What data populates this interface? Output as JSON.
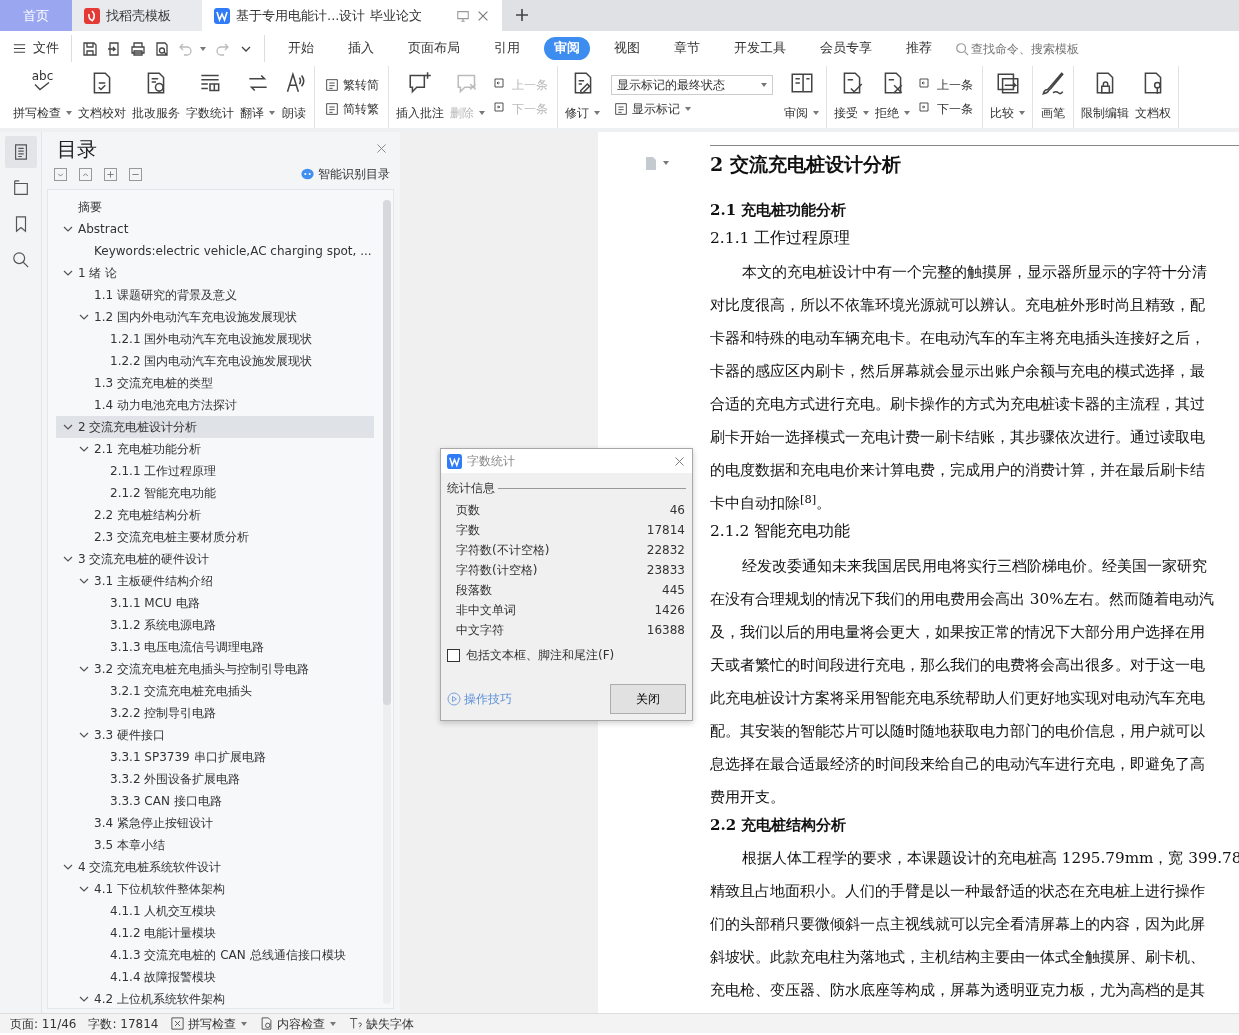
{
  "browser_tabs": [
    {
      "kind": "home",
      "label": "首页",
      "selected": false
    },
    {
      "kind": "template",
      "label": "找稻壳模板",
      "selected": false
    },
    {
      "kind": "document",
      "label": "基于专用电能计...设计 毕业论文",
      "selected": true
    }
  ],
  "menu": {
    "file": "文件",
    "quick_access": [
      {
        "kind": "save",
        "disabled": false
      },
      {
        "kind": "export",
        "disabled": false
      },
      {
        "kind": "print",
        "disabled": false
      },
      {
        "kind": "preview",
        "disabled": false
      },
      {
        "kind": "undo",
        "disabled": true
      },
      {
        "kind": "redo",
        "disabled": true
      },
      {
        "kind": "more",
        "disabled": false
      }
    ],
    "tabs": [
      {
        "label": "开始",
        "selected": false
      },
      {
        "label": "插入",
        "selected": false
      },
      {
        "label": "页面布局",
        "selected": false
      },
      {
        "label": "引用",
        "selected": false
      },
      {
        "label": "审阅",
        "selected": true
      },
      {
        "label": "视图",
        "selected": false
      },
      {
        "label": "章节",
        "selected": false
      },
      {
        "label": "开发工具",
        "selected": false
      },
      {
        "label": "会员专享",
        "selected": false
      },
      {
        "label": "推荐",
        "selected": false
      }
    ],
    "search": {
      "placeholder": "查找命令、搜索模板"
    }
  },
  "ribbon_groups": [
    {
      "items": [
        {
          "kind": "big",
          "glyph": "abc",
          "label": "拼写检查",
          "dropdown": true,
          "disabled": false
        },
        {
          "kind": "big",
          "label": "文档校对",
          "dropdown": false,
          "disabled": false
        },
        {
          "kind": "big",
          "label": "批改服务",
          "dropdown": false,
          "disabled": false
        },
        {
          "kind": "big",
          "label": "字数统计",
          "dropdown": false,
          "disabled": false
        },
        {
          "kind": "big",
          "label": "翻译",
          "dropdown": true,
          "disabled": false
        },
        {
          "kind": "big",
          "label": "朗读",
          "dropdown": false,
          "disabled": false
        }
      ]
    },
    {
      "items": [
        {
          "kind": "pair",
          "items": [
            {
              "label": "繁转简",
              "disabled": false
            },
            {
              "label": "简转繁",
              "disabled": false
            }
          ]
        }
      ]
    },
    {
      "items": [
        {
          "kind": "big",
          "label": "插入批注",
          "dropdown": false,
          "disabled": false
        },
        {
          "kind": "big",
          "label": "删除",
          "dropdown": true,
          "disabled": true
        },
        {
          "kind": "pair",
          "items": [
            {
              "label": "上一条",
              "disabled": true
            },
            {
              "label": "下一条",
              "disabled": true
            }
          ]
        }
      ]
    },
    {
      "items": [
        {
          "kind": "big",
          "label": "修订",
          "dropdown": true,
          "disabled": false
        },
        {
          "kind": "select",
          "value": "显示标记的最终状态",
          "below": {
            "label": "显示标记",
            "dropdown": true
          }
        },
        {
          "kind": "big",
          "label": "审阅",
          "dropdown": true,
          "disabled": false
        }
      ]
    },
    {
      "items": [
        {
          "kind": "big",
          "label": "接受",
          "dropdown": true,
          "disabled": false
        },
        {
          "kind": "big",
          "label": "拒绝",
          "dropdown": true,
          "disabled": false
        },
        {
          "kind": "pair",
          "items": [
            {
              "label": "上一条",
              "disabled": false
            },
            {
              "label": "下一条",
              "disabled": false
            }
          ]
        }
      ]
    },
    {
      "items": [
        {
          "kind": "big",
          "label": "比较",
          "dropdown": true,
          "disabled": false
        }
      ]
    },
    {
      "items": [
        {
          "kind": "big",
          "label": "画笔",
          "dropdown": false,
          "disabled": false
        }
      ]
    },
    {
      "items": [
        {
          "kind": "big",
          "label": "限制编辑",
          "dropdown": false,
          "disabled": false
        },
        {
          "kind": "big",
          "label": "文档权",
          "dropdown": false,
          "disabled": false
        }
      ]
    }
  ],
  "side_rail": [
    {
      "kind": "outline",
      "selected": true
    },
    {
      "kind": "pages",
      "selected": false
    },
    {
      "kind": "bookmark",
      "selected": false
    },
    {
      "kind": "search",
      "selected": false
    }
  ],
  "nav_pane": {
    "title": "目录",
    "tools": [
      {
        "kind": "expand"
      },
      {
        "kind": "collapse"
      },
      {
        "kind": "plus"
      },
      {
        "kind": "minus"
      }
    ],
    "smart_button": "智能识别目录",
    "tree": [
      {
        "label": "摘要",
        "selected": false
      },
      {
        "label": "Abstract",
        "expanded": true,
        "selected": false,
        "children": [
          {
            "label": "Keywords:electric vehicle,AC charging spot, ...",
            "selected": false
          }
        ]
      },
      {
        "label": "1  绪  论",
        "expanded": true,
        "selected": false,
        "children": [
          {
            "label": "1.1  课题研究的背景及意义",
            "selected": false
          },
          {
            "label": "1.2  国内外电动汽车充电设施发展现状",
            "expanded": true,
            "selected": false,
            "children": [
              {
                "label": "1.2.1  国外电动汽车充电设施发展现状",
                "selected": false
              },
              {
                "label": "1.2.2  国内电动汽车充电设施发展现状",
                "selected": false
              }
            ]
          },
          {
            "label": "1.3  交流充电桩的类型",
            "selected": false
          },
          {
            "label": "1.4  动力电池充电方法探讨",
            "selected": false
          }
        ]
      },
      {
        "label": "2  交流充电桩设计分析",
        "expanded": true,
        "selected": true,
        "children": [
          {
            "label": "2.1 充电桩功能分析",
            "expanded": true,
            "selected": false,
            "children": [
              {
                "label": "2.1.1  工作过程原理",
                "selected": false
              },
              {
                "label": "2.1.2  智能充电功能",
                "selected": false
              }
            ]
          },
          {
            "label": "2.2  充电桩结构分析",
            "selected": false
          },
          {
            "label": "2.3  交流充电桩主要材质分析",
            "selected": false
          }
        ]
      },
      {
        "label": "3  交流充电桩的硬件设计",
        "expanded": true,
        "selected": false,
        "children": [
          {
            "label": "3.1  主板硬件结构介绍",
            "expanded": true,
            "selected": false,
            "children": [
              {
                "label": "3.1.1 MCU 电路",
                "selected": false
              },
              {
                "label": "3.1.2  系统电源电路",
                "selected": false
              },
              {
                "label": "3.1.3 电压电流信号调理电路",
                "selected": false
              }
            ]
          },
          {
            "label": "3.2  交流充电桩充电插头与控制引导电路",
            "expanded": true,
            "selected": false,
            "children": [
              {
                "label": "3.2.1  交流充电桩充电插头",
                "selected": false
              },
              {
                "label": "3.2.2  控制导引电路",
                "selected": false
              }
            ]
          },
          {
            "label": "3.3  硬件接口",
            "expanded": true,
            "selected": false,
            "children": [
              {
                "label": "3.3.1 SP3739 串口扩展电路",
                "selected": false
              },
              {
                "label": "3.3.2  外围设备扩展电路",
                "selected": false
              },
              {
                "label": "3.3.3 CAN  接口电路",
                "selected": false
              }
            ]
          },
          {
            "label": "3.4  紧急停止按钮设计",
            "selected": false
          },
          {
            "label": "3.5  本章小结",
            "selected": false
          }
        ]
      },
      {
        "label": "4  交流充电桩系统软件设计",
        "expanded": true,
        "selected": false,
        "children": [
          {
            "label": "4.1 下位机软件整体架构",
            "expanded": true,
            "selected": false,
            "children": [
              {
                "label": "4.1.1  人机交互模块",
                "selected": false
              },
              {
                "label": "4.1.2  电能计量模块",
                "selected": false
              },
              {
                "label": "4.1.3 交流充电桩的 CAN 总线通信接口模块",
                "selected": false
              },
              {
                "label": "4.1.4 故障报警模块",
                "selected": false
              }
            ]
          },
          {
            "label": "4.2 上位机系统软件架构",
            "expanded": true,
            "selected": false
          }
        ]
      }
    ]
  },
  "document": [
    {
      "kind": "h1",
      "text": "2  交流充电桩设计分析"
    },
    {
      "kind": "h2",
      "text": "2.1 充电桩功能分析"
    },
    {
      "kind": "h3",
      "text": "2.1.1  工作过程原理"
    },
    {
      "kind": "para",
      "lines": [
        "本文的充电桩设计中有一个完整的触摸屏，显示器所显示的字符十分清",
        "对比度很高，所以不依靠环境光源就可以辨认。充电桩外形时尚且精致，配",
        "卡器和特殊的电动车辆充电卡。在电动汽车的车主将充电插头连接好之后，",
        "卡器的感应区内刷卡，然后屏幕就会显示出账户余额与充电的模式选择，最",
        "合适的充电方式进行充电。刷卡操作的方式为充电桩读卡器的主流程，其过",
        "刷卡开始一选择模式一充电计费一刷卡结账，其步骤依次进行。通过读取电",
        "的电度数据和充电电价来计算电费，完成用户的消费计算，并在最后刷卡结",
        "卡中自动扣除$^{[8]}$。"
      ]
    },
    {
      "kind": "h3",
      "text": "2.1.2  智能充电功能"
    },
    {
      "kind": "para",
      "lines": [
        "经发改委通知未来我国居民用电将实行三档阶梯电价。经美国一家研究",
        "在没有合理规划的情况下我们的用电费用会高出 30%左右。然而随着电动汽",
        "及，我们以后的用电量将会更大，如果按正常的情况下大部分用户选择在用",
        "天或者繁忙的时间段进行充电，那么我们的电费将会高出很多。对于这一电",
        "此充电桩设计方案将采用智能充电系统帮助人们更好地实现对电动汽车充电",
        "配。其安装的智能芯片可以随时随地获取电力部门的电价信息，用户就可以",
        "息选择在最合适最经济的时间段来给自己的电动汽车进行充电，即避免了高",
        "费用开支。"
      ]
    },
    {
      "kind": "h2",
      "text": "2.2  充电桩结构分析"
    },
    {
      "kind": "para",
      "lines": [
        "根据人体工程学的要求，本课题设计的充电桩高 1295.79mm，宽 399.78",
        "精致且占地面积小。人们的手臂是以一种最舒适的状态在充电桩上进行操作",
        "们的头部稍只要微倾斜一点主视线就可以完全看清屏幕上的内容，因为此屏",
        "斜坡状。此款充电柱为落地式，主机结构主要由一体式全触摸屏、刷卡机、",
        "充电枪、变压器、防水底座等构成，屏幕为透明亚克力板，尤为高档的是其"
      ]
    }
  ],
  "dialog": {
    "title": "字数统计",
    "group": "统计信息",
    "rows": [
      {
        "label": "页数",
        "value": "46"
      },
      {
        "label": "字数",
        "value": "17814"
      },
      {
        "label": "字符数(不计空格)",
        "value": "22832"
      },
      {
        "label": "字符数(计空格)",
        "value": "23833"
      },
      {
        "label": "段落数",
        "value": "445"
      },
      {
        "label": "非中文单词",
        "value": "1426"
      },
      {
        "label": "中文字符",
        "value": "16388"
      }
    ],
    "checkbox": {
      "label": "包括文本框、脚注和尾注(F)",
      "checked": false
    },
    "tips_link": "操作技巧",
    "close_button": "关闭"
  },
  "status_bar": {
    "page": "页面: 11/46",
    "words": "字数: 17814",
    "items": [
      {
        "label": "拼写检查",
        "dropdown": true
      },
      {
        "label": "内容检查",
        "dropdown": true
      },
      {
        "label": "缺失字体",
        "dropdown": false
      }
    ]
  }
}
